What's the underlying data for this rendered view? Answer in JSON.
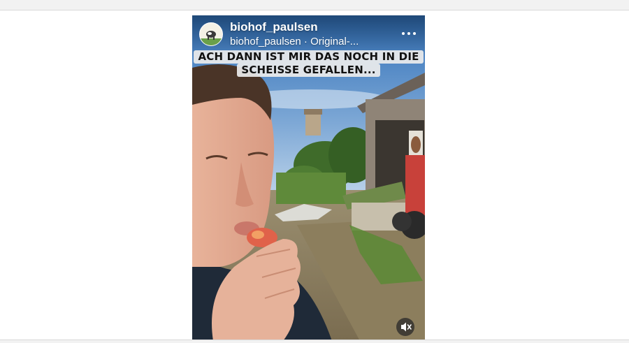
{
  "post": {
    "username": "biohof_paulsen",
    "subtitle": "biohof_paulsen · Original-...",
    "caption_lines": [
      "ACH DANN IST MIR DAS NOCH IN DIE",
      "SCHEISSE GEFALLEN..."
    ]
  },
  "icons": {
    "more": "more-horizontal-icon",
    "mute": "speaker-muted-icon",
    "avatar": "avatar-cow-logo"
  },
  "colors": {
    "caption_bg": "#ebebeb",
    "caption_text": "#111111",
    "header_text": "#ffffff"
  }
}
